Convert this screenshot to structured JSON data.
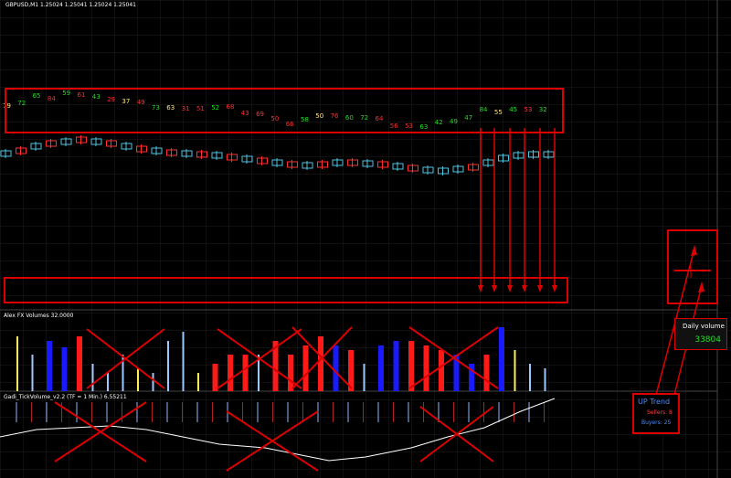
{
  "main_chart": {
    "title": "GBPUSD,M1  1.25024 1.25041 1.25024 1.25041"
  },
  "volume_indicator": {
    "title": "Alex FX Volumes 32.0000"
  },
  "tick_indicator": {
    "title": "Gadi_TickVolume_v2.2 (TF = 1 Min.) 6.55211"
  },
  "daily_volume": {
    "label": "Daily volume",
    "value": "33804"
  },
  "trend_panel": {
    "heading": "UP Trend",
    "sellers": "Sellers: 8",
    "buyers": "Buyers: 25"
  },
  "tick_numbers": [
    {
      "v": "79",
      "c": "y"
    },
    {
      "v": "72",
      "c": "g"
    },
    {
      "v": "65",
      "c": "g"
    },
    {
      "v": "84",
      "c": "r"
    },
    {
      "v": "59",
      "c": "g"
    },
    {
      "v": "61",
      "c": "r"
    },
    {
      "v": "43",
      "c": "g"
    },
    {
      "v": "29",
      "c": "r"
    },
    {
      "v": "37",
      "c": "y"
    },
    {
      "v": "49",
      "c": "r"
    },
    {
      "v": "73",
      "c": "g"
    },
    {
      "v": "63",
      "c": "y"
    },
    {
      "v": "31",
      "c": "r"
    },
    {
      "v": "51",
      "c": "r"
    },
    {
      "v": "52",
      "c": "g"
    },
    {
      "v": "68",
      "c": "r"
    },
    {
      "v": "43",
      "c": "r"
    },
    {
      "v": "69",
      "c": "r"
    },
    {
      "v": "50",
      "c": "r"
    },
    {
      "v": "66",
      "c": "r"
    },
    {
      "v": "58",
      "c": "g"
    },
    {
      "v": "50",
      "c": "y"
    },
    {
      "v": "76",
      "c": "r"
    },
    {
      "v": "60",
      "c": "g"
    },
    {
      "v": "72",
      "c": "g"
    },
    {
      "v": "64",
      "c": "r"
    },
    {
      "v": "56",
      "c": "r"
    },
    {
      "v": "53",
      "c": "r"
    },
    {
      "v": "63",
      "c": "g"
    },
    {
      "v": "42",
      "c": "g"
    },
    {
      "v": "49",
      "c": "g"
    },
    {
      "v": "47",
      "c": "g"
    },
    {
      "v": "84",
      "c": "g"
    },
    {
      "v": "55",
      "c": "y"
    },
    {
      "v": "45",
      "c": "g"
    },
    {
      "v": "53",
      "c": "r"
    },
    {
      "v": "32",
      "c": "g"
    }
  ],
  "colors": {
    "annotation_red": "#dd0000",
    "up_candle": "#4fc3e0",
    "down_candle": "#ff3030",
    "volume_blue": "#1a1aff",
    "volume_red": "#ff1a1a",
    "volume_yellow": "#ffee55",
    "volume_lightblue": "#9fc8ff"
  }
}
